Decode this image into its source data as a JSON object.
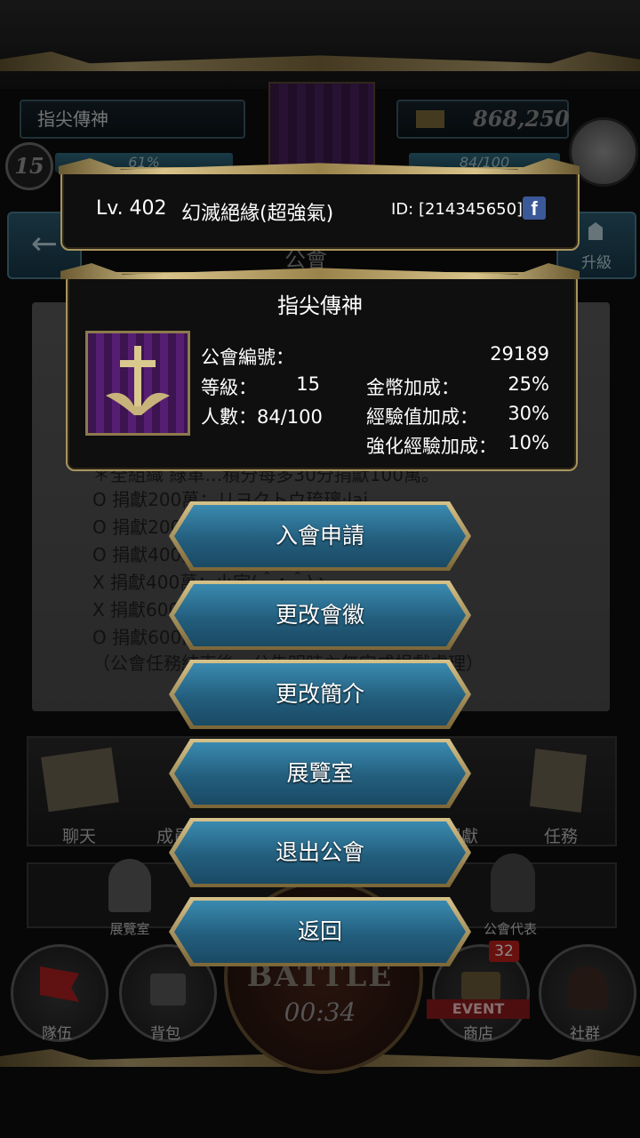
{
  "background": {
    "guild_name": "指尖傳神",
    "gold": "868,250",
    "level_badge": "15",
    "exp_percent": "61%",
    "members_bar": "84/100",
    "upgrade_label": "升級",
    "screen_title": "公會",
    "notice_lines": [
      "＊全組織    綠革…積分每多30分捐獻100萬。",
      "O 捐獻200萬：リヨクトウ琉璃·lai",
      "O 捐獻200萬",
      "O 捐獻400萬",
      "X 捐獻400萬：小宇(＾∧＾)ゝ",
      "X 捐獻600萬",
      "O 捐獻600萬",
      "（公會任務結束後，公告明時內無完成捐獻處理）"
    ],
    "icon_row": [
      "聊天",
      "成員",
      "捐獻",
      "任務"
    ],
    "row2": [
      "展覽室",
      "公會代表"
    ],
    "bottom_nav": [
      "隊伍",
      "背包",
      "商店",
      "社群"
    ],
    "battle_label": "BATTLE",
    "battle_timer": "00:34",
    "event_label": "EVENT",
    "shop_count": "32"
  },
  "player": {
    "level": "Lv. 402",
    "name": "幻滅絕緣(超強氣)",
    "id": "ID: [214345650]",
    "facebook_icon": "f"
  },
  "guild_info": {
    "title": "指尖傳神",
    "emblem": "cross-emblem",
    "guild_no_label": "公會編號：",
    "guild_no_value": "29189",
    "level_label": "等級：",
    "level_value": "15",
    "members_label": "人數：84/100",
    "gold_bonus_label": "金幣加成：",
    "gold_bonus_value": "25%",
    "exp_bonus_label": "經驗值加成：",
    "exp_bonus_value": "30%",
    "enhance_bonus_label": "強化經驗加成：",
    "enhance_bonus_value": "10%"
  },
  "menu": {
    "join": "入會申請",
    "change_badge": "更改會徽",
    "change_intro": "更改簡介",
    "gallery": "展覽室",
    "leave": "退出公會",
    "back": "返回"
  },
  "colors": {
    "gold_frame": "#a8945e",
    "button_blue": "#235e7d",
    "panel_bg": "#0f0f0f"
  }
}
